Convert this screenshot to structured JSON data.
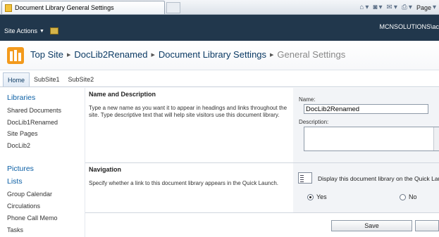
{
  "browser": {
    "tab_title": "Document Library General Settings",
    "commands": {
      "page_label": "Page"
    }
  },
  "sharepoint": {
    "site_actions_label": "Site Actions",
    "user_name": "MCNSOLUTIONS\\ac"
  },
  "breadcrumb": {
    "items": [
      "Top Site",
      "DocLib2Renamed",
      "Document Library Settings"
    ],
    "current": "General Settings"
  },
  "topnav": {
    "items": [
      "Home",
      "SubSite1",
      "SubSite2"
    ]
  },
  "quicklaunch": {
    "libraries_heading": "Libraries",
    "libraries": [
      "Shared Documents",
      "DocLib1Renamed",
      "Site Pages",
      "DocLib2"
    ],
    "pictures_heading": "Pictures",
    "lists_heading": "Lists",
    "lists": [
      "Group Calendar",
      "Circulations",
      "Phone Call Memo",
      "Tasks"
    ]
  },
  "name_section": {
    "title": "Name and Description",
    "description": "Type a new name as you want it to appear in headings and links throughout the site. Type descriptive text that will help site visitors use this document library.",
    "name_label": "Name:",
    "name_value": "DocLib2Renamed",
    "description_label": "Description:"
  },
  "navigation_section": {
    "title": "Navigation",
    "description": "Specify whether a link to this document library appears in the Quick Launch.",
    "option_label": "Display this document library on the Quick Launch?",
    "yes_label": "Yes",
    "no_label": "No",
    "selected": "Yes"
  },
  "buttons": {
    "save_label": "Save"
  }
}
